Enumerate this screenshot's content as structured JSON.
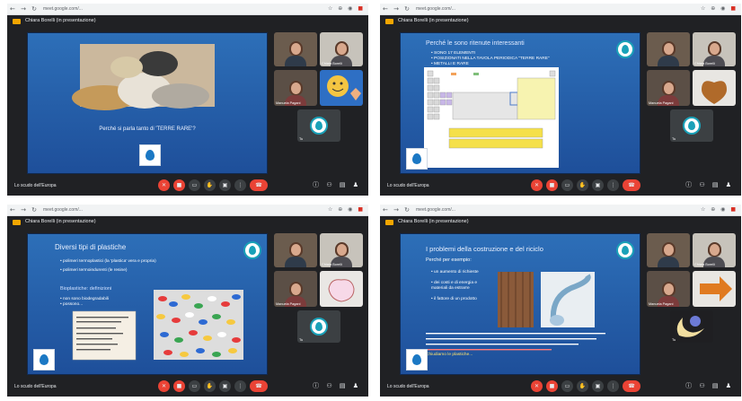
{
  "browser": {
    "nav_glyphs": "← → ↻",
    "url": "meet.google.com/...",
    "ext_glyphs": "☆ ⊕ ◉",
    "ext_red": "■"
  },
  "meeting": {
    "presenter_title": "Chiara Borelli (in presentazione)",
    "meeting_name": "Lo scudo dell'Europa"
  },
  "panels": [
    {
      "slide": {
        "caption": "Perché si parla tanto di 'TERRE RARE'?"
      },
      "tiles": [
        "",
        "Chiara Borelli",
        "Manuela Pagani",
        "",
        "Tu"
      ]
    },
    {
      "slide": {
        "header": "Perché le sono ritenute interessanti",
        "bullets": [
          "• SONO 17 ELEMENTI",
          "• POSIZIONATI NELLA TAVOLA PERIODICA \"TERRE RARE\"",
          "• METALLI E RARE"
        ]
      },
      "tiles": [
        "",
        "Chiara Borelli",
        "Manuela Pagani",
        "",
        "Tu"
      ]
    },
    {
      "slide": {
        "header": "Diversi tipi di plastiche",
        "bullets": [
          "• polimeri termoplastici (la 'plastica' vera e propria)",
          "• polimeri termoindurenti (le resine)"
        ],
        "sub": "Bioplastiche: definizioni",
        "bullets2": [
          "• non sono biodegradabili",
          "• possono..."
        ]
      },
      "tiles": [
        "",
        "Chiara Borelli",
        "Manuela Pagani",
        "",
        "Tu"
      ]
    },
    {
      "slide": {
        "header": "I problemi della costruzione e del riciclo",
        "sub": "Perché per esempio:",
        "bullets": [
          "• un aumento di richieste",
          "• dei costi e di energia e materiali da estrarre",
          "• il fattore di un prodotto"
        ],
        "footer": "Chiudiamo le plastiche..."
      },
      "tiles": [
        "",
        "Chiara Borelli",
        "Manuela Pagani",
        "",
        "Tu"
      ]
    }
  ],
  "controls": {
    "buttons": [
      "mic",
      "cam",
      "cc",
      "hand",
      "present",
      "more",
      "end"
    ],
    "mic_glyph": "✕",
    "cam_glyph": "■",
    "cc_glyph": "▭",
    "hand_glyph": "✋",
    "present_glyph": "▣",
    "more_glyph": "⋮",
    "end_glyph": "☎",
    "right_glyphs": "ⓘ ⚇ ▤ ♟"
  }
}
